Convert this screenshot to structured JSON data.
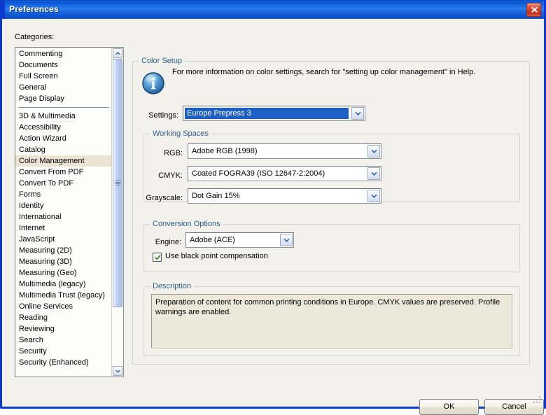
{
  "window": {
    "title": "Preferences",
    "close_icon": "close-icon",
    "accent_titlebar": "#1464e0",
    "close_button_color": "#cf3b22",
    "dialog_background": "#f2f1ec"
  },
  "sidebar": {
    "label": "Categories:",
    "selected": "Color Management",
    "group_one": [
      {
        "label": "Commenting"
      },
      {
        "label": "Documents"
      },
      {
        "label": "Full Screen"
      },
      {
        "label": "General"
      },
      {
        "label": "Page Display"
      }
    ],
    "group_two": [
      {
        "label": "3D & Multimedia"
      },
      {
        "label": "Accessibility"
      },
      {
        "label": "Action Wizard"
      },
      {
        "label": "Catalog"
      },
      {
        "label": "Color Management"
      },
      {
        "label": "Convert From PDF"
      },
      {
        "label": "Convert To PDF"
      },
      {
        "label": "Forms"
      },
      {
        "label": "Identity"
      },
      {
        "label": "International"
      },
      {
        "label": "Internet"
      },
      {
        "label": "JavaScript"
      },
      {
        "label": "Measuring (2D)"
      },
      {
        "label": "Measuring (3D)"
      },
      {
        "label": "Measuring (Geo)"
      },
      {
        "label": "Multimedia (legacy)"
      },
      {
        "label": "Multimedia Trust (legacy)"
      },
      {
        "label": "Online Services"
      },
      {
        "label": "Reading"
      },
      {
        "label": "Reviewing"
      },
      {
        "label": "Search"
      },
      {
        "label": "Security"
      },
      {
        "label": "Security (Enhanced)"
      }
    ],
    "scrollbar": {
      "up_icon": "chevron-up-icon",
      "down_icon": "chevron-down-icon"
    }
  },
  "color_setup": {
    "title": "Color Setup",
    "info_icon": "info-icon",
    "info_text": "For more information on color settings, search for \"setting up color management\" in Help.",
    "settings_label": "Settings:",
    "settings_value": "Europe Prepress 3",
    "settings_arrow_icon": "chevron-down-icon"
  },
  "working_spaces": {
    "title": "Working Spaces",
    "fields": [
      {
        "label": "RGB:",
        "value": "Adobe RGB (1998)",
        "arrow_icon": "chevron-down-icon"
      },
      {
        "label": "CMYK:",
        "value": "Coated FOGRA39 (ISO 12647-2:2004)",
        "arrow_icon": "chevron-down-icon"
      },
      {
        "label": "Grayscale:",
        "value": "Dot Gain 15%",
        "arrow_icon": "chevron-down-icon"
      }
    ]
  },
  "conversion_options": {
    "title": "Conversion Options",
    "engine_label": "Engine:",
    "engine_value": "Adobe (ACE)",
    "engine_arrow_icon": "chevron-down-icon",
    "black_point_label": "Use black point compensation",
    "black_point_checked": true,
    "check_icon": "checkmark-icon",
    "check_color": "#3a8a2e"
  },
  "description": {
    "title": "Description",
    "text": "Preparation of content for common printing conditions in Europe. CMYK values are preserved. Profile warnings are enabled."
  },
  "footer": {
    "ok_label": "OK",
    "cancel_label": "Cancel",
    "resize_grip_icon": "resize-grip-icon"
  }
}
